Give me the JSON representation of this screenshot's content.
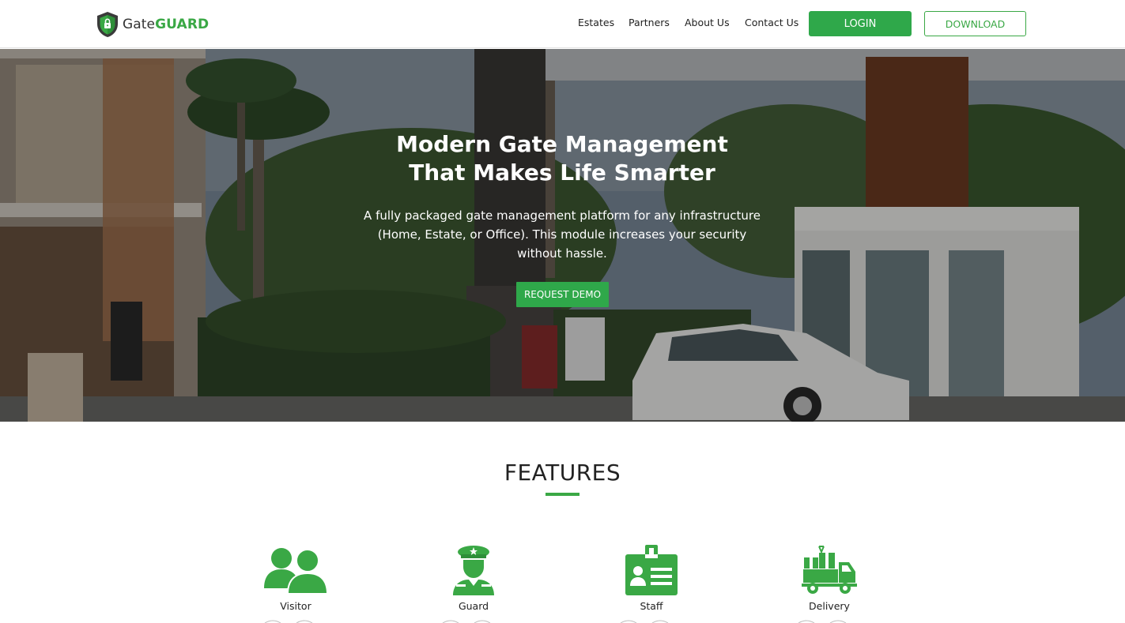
{
  "brand": {
    "name_part1": "Gate",
    "name_part2": "GUARD",
    "logo_icon": "shield-lock-icon",
    "accent_color": "#3aa845"
  },
  "nav": {
    "items": [
      "Estates",
      "Partners",
      "About Us",
      "Contact Us"
    ],
    "login_label": "LOGIN",
    "download_label": "DOWNLOAD"
  },
  "hero": {
    "title_line1": "Modern Gate Management",
    "title_line2": "That Makes Life Smarter",
    "subtitle_line1": "A fully packaged gate management platform for any infrastructure",
    "subtitle_line2": "(Home, Estate, or Office). This module increases your security",
    "subtitle_line3": "without hassle.",
    "cta_label": "REQUEST DEMO"
  },
  "features": {
    "title": "FEATURES",
    "items": [
      {
        "label": "Visitor",
        "icon": "visitors-icon"
      },
      {
        "label": "Guard",
        "icon": "guard-icon"
      },
      {
        "label": "Staff",
        "icon": "staff-id-badge-icon"
      },
      {
        "label": "Delivery",
        "icon": "delivery-truck-icon"
      }
    ]
  }
}
